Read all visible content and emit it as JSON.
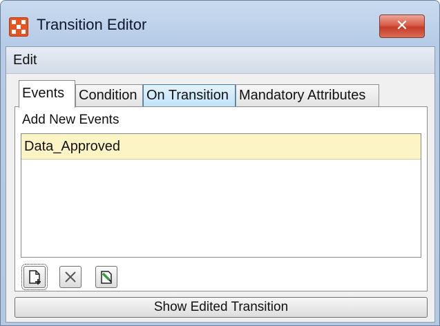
{
  "window": {
    "title": "Transition Editor",
    "close_label": "✕",
    "icons": {
      "app": "app-icon",
      "close": "close-icon"
    }
  },
  "menu": {
    "items": [
      "Edit"
    ]
  },
  "tabs": [
    {
      "label": "Events",
      "active": true
    },
    {
      "label": "Condition",
      "active": false
    },
    {
      "label": "On Transition",
      "active": false,
      "highlighted": true
    },
    {
      "label": "Mandatory Attributes",
      "active": false
    }
  ],
  "events": {
    "heading": "Add New Events",
    "items": [
      "Data_Approved"
    ],
    "buttons": [
      {
        "name": "add-event-button",
        "icon": "new-document-icon"
      },
      {
        "name": "delete-event-button",
        "icon": "delete-x-icon"
      },
      {
        "name": "edit-event-button",
        "icon": "edit-pencil-icon"
      }
    ]
  },
  "footer": {
    "button_label": "Show Edited Transition"
  },
  "colors": {
    "titlebar": "#b6cbe6",
    "close_button": "#c53d29",
    "selected_row": "#fdf4c5",
    "tab_hover": "#bfe3f8",
    "app_icon": "#e8531f"
  }
}
